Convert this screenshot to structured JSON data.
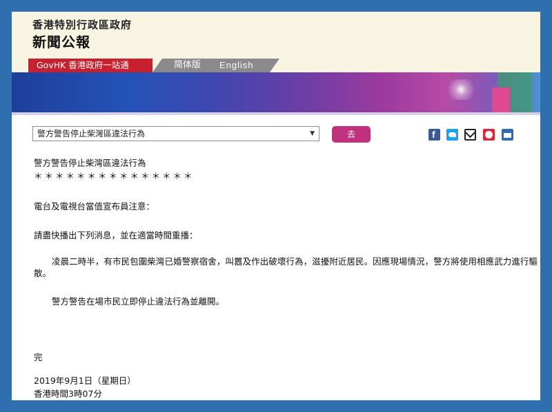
{
  "header": {
    "department": "香港特別行政區政府",
    "title": "新聞公報"
  },
  "nav": {
    "govhk": "GovHK 香港政府一站通",
    "simplified": "简体版",
    "english": "English"
  },
  "toolbar": {
    "selected_article": "警方警告停止柴灣區違法行為",
    "go_label": "去",
    "share_icons": [
      "facebook-icon",
      "twitter-icon",
      "email-icon",
      "weibo-icon",
      "print-icon"
    ]
  },
  "article": {
    "title": "警方警告停止柴灣區違法行為",
    "separator": "＊＊＊＊＊＊＊＊＊＊＊＊＊＊＊",
    "notice": "電台及電視台當值宣布員注意：",
    "instruction": "請盡快播出下列消息，並在適當時間重播：",
    "body_1": "凌晨二時半，有市民包圍柴灣已婚警察宿舍，叫囂及作出破壞行為，滋擾附近居民。因應現場情況，警方將使用相應武力進行驅散。",
    "body_2": "警方警告在場市民立即停止違法行為並離開。",
    "end": "完",
    "date": "2019年9月1日（星期日）",
    "time": "香港時間3時07分"
  },
  "colors": {
    "page_border": "#2f6fb0",
    "govhk_red": "#c8202f",
    "go_button": "#c0337c",
    "header_bg": "#f7f4e2"
  }
}
